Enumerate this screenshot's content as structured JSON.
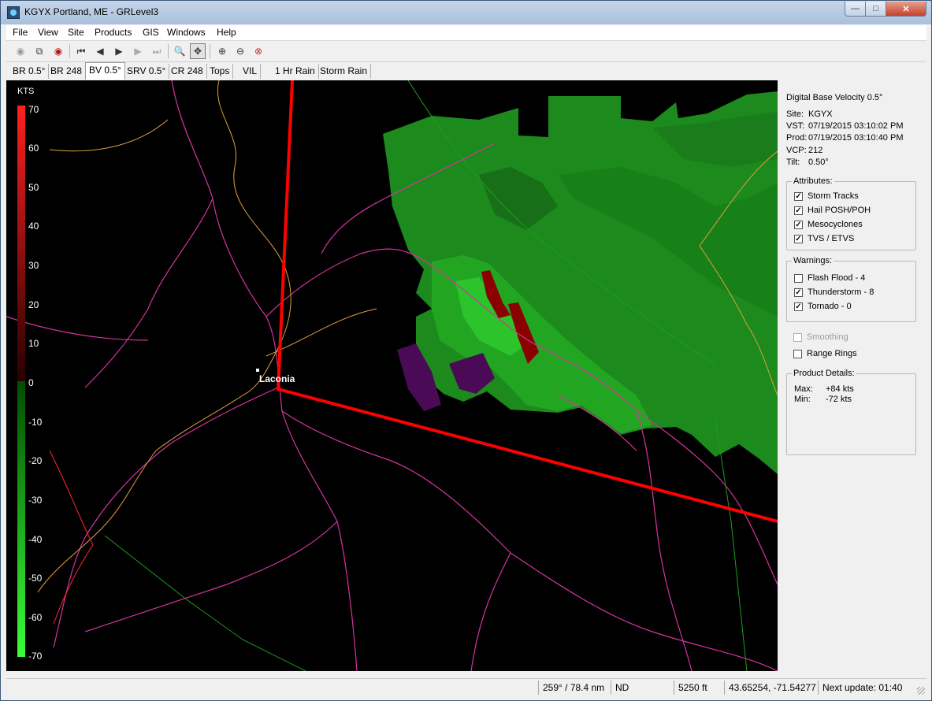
{
  "window": {
    "title": "KGYX Portland, ME - GRLevel3"
  },
  "menu": [
    "File",
    "View",
    "Site",
    "Products",
    "GIS",
    "Windows",
    "Help"
  ],
  "toolbar": {
    "icons": [
      "grey-circle-icon",
      "copy-icon",
      "red-record-icon",
      "first-frame-icon",
      "prev-frame-icon",
      "play-icon",
      "next-frame-icon",
      "last-frame-icon",
      "zoom-icon",
      "pan-icon",
      "zoom-in-icon",
      "zoom-out-icon",
      "zoom-reset-icon"
    ]
  },
  "tabs": [
    "BR 0.5°",
    "BR 248",
    "BV 0.5°",
    "SRV 0.5°",
    "CR 248",
    "Tops",
    "VIL",
    "1 Hr Rain",
    "Storm Rain"
  ],
  "active_tab": "BV 0.5°",
  "legend": {
    "unit": "KTS",
    "labels": [
      "70",
      "60",
      "50",
      "40",
      "30",
      "20",
      "10",
      "0",
      "-10",
      "-20",
      "-30",
      "-40",
      "-50",
      "-60",
      "-70"
    ]
  },
  "map": {
    "city": "Laconia"
  },
  "info": {
    "product": "Digital Base Velocity 0.5°",
    "site_label": "Site:",
    "site_value": "KGYX",
    "vst_label": "VST:",
    "vst_value": "07/19/2015  03:10:02 PM",
    "prod_label": "Prod:",
    "prod_value": "07/19/2015  03:10:40 PM",
    "vcp_label": "VCP:",
    "vcp_value": "212",
    "tilt_label": "Tilt:",
    "tilt_value": "0.50°"
  },
  "attributes": {
    "title": "Attributes:",
    "items": [
      {
        "label": "Storm Tracks",
        "checked": true
      },
      {
        "label": "Hail POSH/POH",
        "checked": true
      },
      {
        "label": "Mesocyclones",
        "checked": true
      },
      {
        "label": "TVS / ETVS",
        "checked": true
      }
    ]
  },
  "warnings": {
    "title": "Warnings:",
    "items": [
      {
        "label": "Flash Flood - 4",
        "checked": false
      },
      {
        "label": "Thunderstorm - 8",
        "checked": true
      },
      {
        "label": "Tornado - 0",
        "checked": true
      }
    ]
  },
  "options": {
    "smoothing": "Smoothing",
    "range_rings": "Range Rings"
  },
  "product_details": {
    "title": "Product Details:",
    "max_label": "Max:",
    "max_value": "+84 kts",
    "min_label": "Min:",
    "min_value": "-72 kts"
  },
  "status": {
    "bearing": "259° / 78.4 nm",
    "nd": "ND",
    "height": "5250 ft",
    "coords": "43.65254, -71.54277",
    "next_update": "Next update: 01:40"
  },
  "colors": {
    "inbound": "#1fa01f",
    "outbound": "#8b0000",
    "roads_major": "#d6339f",
    "roads_minor": "#e0a040",
    "warning_polygon": "#ff0000"
  }
}
